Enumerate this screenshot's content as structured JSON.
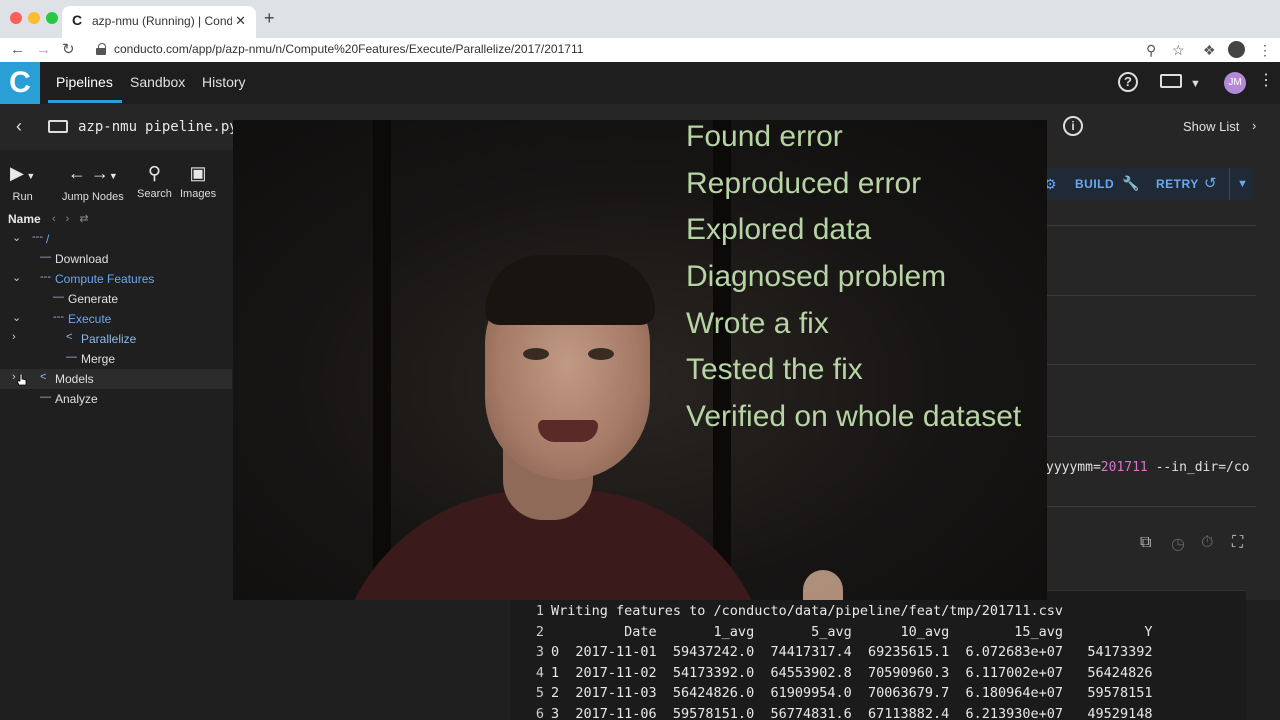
{
  "browser": {
    "tab_title": "azp-nmu (Running) | Conducto",
    "tab_favicon": "C",
    "tab_close": "✕",
    "new_tab": "+",
    "url": "conducto.com/app/p/azp-nmu/n/Compute%20Features/Execute/Parallelize/2017/201711"
  },
  "header": {
    "logo": "C",
    "nav": [
      "Pipelines",
      "Sandbox",
      "History"
    ],
    "user_initials": "JM",
    "accent_color": "#2a9fd6"
  },
  "subheader": {
    "pipeline_id": "azp-nmu",
    "file": "pipeline.py ma",
    "show_list": "Show List"
  },
  "toolbar": {
    "run": "Run",
    "jump_nodes": "Jump Nodes",
    "search": "Search",
    "images": "Images"
  },
  "tree": {
    "header": "Name",
    "rows": [
      {
        "label": "/",
        "type": "root"
      },
      {
        "label": "Download",
        "type": "leaf"
      },
      {
        "label": "Compute Features",
        "type": "serial"
      },
      {
        "label": "Generate",
        "type": "leaf"
      },
      {
        "label": "Execute",
        "type": "serial"
      },
      {
        "label": "Parallelize",
        "type": "parallel"
      },
      {
        "label": "Merge",
        "type": "leaf"
      },
      {
        "label": "Models",
        "type": "parallel"
      },
      {
        "label": "Analyze",
        "type": "leaf"
      }
    ]
  },
  "detail": {
    "build": "BUILD",
    "retry": "RETRY",
    "command_prefix": "yyyymm=",
    "command_value": "201711",
    "command_suffix": " --in_dir=/co"
  },
  "video_overlay": {
    "checklist": [
      "Found error",
      "Reproduced error",
      "Explored data",
      "Diagnosed problem",
      "Wrote a fix",
      "Tested the fix",
      "Verified on whole dataset"
    ],
    "text_color": "#b6d4a4"
  },
  "log": {
    "lines": [
      {
        "n": "1",
        "text": "Writing features to /conducto/data/pipeline/feat/tmp/201711.csv"
      },
      {
        "n": "2",
        "text": "         Date       1_avg       5_avg      10_avg        15_avg          Y"
      },
      {
        "n": "3",
        "text": "0  2017-11-01  59437242.0  74417317.4  69235615.1  6.072683e+07   54173392"
      },
      {
        "n": "4",
        "text": "1  2017-11-02  54173392.0  64553902.8  70590960.3  6.117002e+07   56424826"
      },
      {
        "n": "5",
        "text": "2  2017-11-03  56424826.0  61909954.0  70063679.7  6.180964e+07   59578151"
      },
      {
        "n": "6",
        "text": "3  2017-11-06  59578151.0  56774831.6  67113882.4  6.213930e+07   49529148"
      }
    ]
  }
}
